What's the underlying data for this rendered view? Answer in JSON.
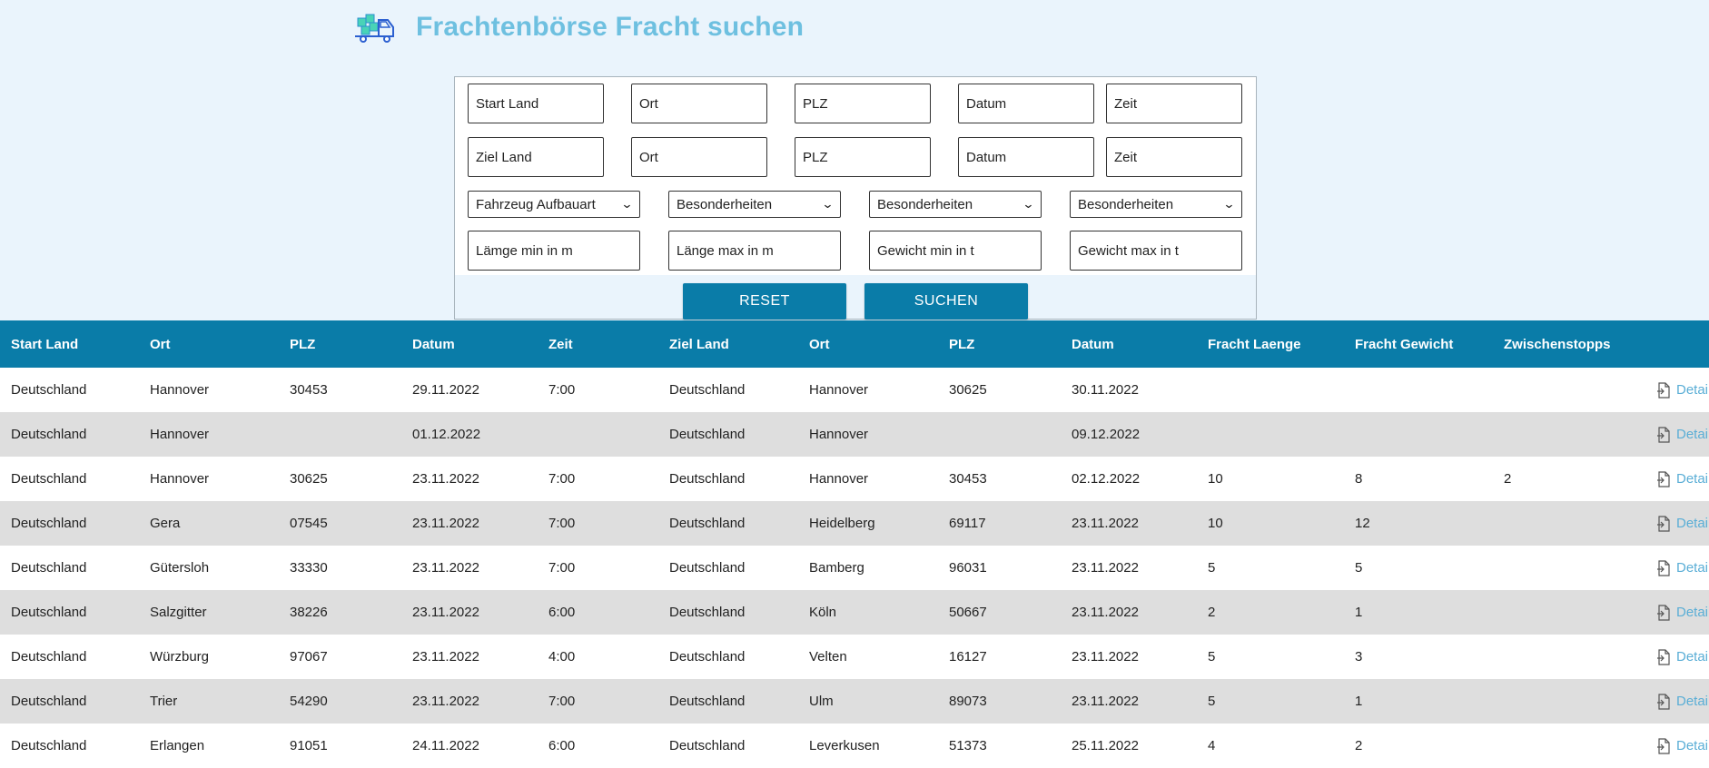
{
  "header": {
    "title": "Frachtenbörse Fracht suchen"
  },
  "search": {
    "start_land": "Start Land",
    "start_ort": "Ort",
    "start_plz": "PLZ",
    "start_datum": "Datum",
    "start_zeit": "Zeit",
    "ziel_land": "Ziel Land",
    "ziel_ort": "Ort",
    "ziel_plz": "PLZ",
    "ziel_datum": "Datum",
    "ziel_zeit": "Zeit",
    "fahrzeug": "Fahrzeug Aufbauart",
    "besonderheiten1": "Besonderheiten",
    "besonderheiten2": "Besonderheiten",
    "besonderheiten3": "Besonderheiten",
    "laenge_min": "Lämge min in m",
    "laenge_max": "Länge max in m",
    "gewicht_min": "Gewicht min in t",
    "gewicht_max": "Gewicht max in t",
    "reset_label": "RESET",
    "suchen_label": "SUCHEN"
  },
  "table": {
    "headers": [
      "Start Land",
      "Ort",
      "PLZ",
      "Datum",
      "Zeit",
      "Ziel Land",
      "Ort",
      "PLZ",
      "Datum",
      "Fracht Laenge",
      "Fracht Gewicht",
      "Zwischenstopps"
    ],
    "details_label": "Details",
    "rows": [
      [
        "Deutschland",
        "Hannover",
        "30453",
        "29.11.2022",
        "7:00",
        "Deutschland",
        "Hannover",
        "30625",
        "30.11.2022",
        "",
        "",
        ""
      ],
      [
        "Deutschland",
        "Hannover",
        "",
        "01.12.2022",
        "",
        "Deutschland",
        "Hannover",
        "",
        "09.12.2022",
        "",
        "",
        ""
      ],
      [
        "Deutschland",
        "Hannover",
        "30625",
        "23.11.2022",
        "7:00",
        "Deutschland",
        "Hannover",
        "30453",
        "02.12.2022",
        "10",
        "8",
        "2"
      ],
      [
        "Deutschland",
        "Gera",
        "07545",
        "23.11.2022",
        "7:00",
        "Deutschland",
        "Heidelberg",
        "69117",
        "23.11.2022",
        "10",
        "12",
        ""
      ],
      [
        "Deutschland",
        "Gütersloh",
        "33330",
        "23.11.2022",
        "7:00",
        "Deutschland",
        "Bamberg",
        "96031",
        "23.11.2022",
        "5",
        "5",
        ""
      ],
      [
        "Deutschland",
        "Salzgitter",
        "38226",
        "23.11.2022",
        "6:00",
        "Deutschland",
        "Köln",
        "50667",
        "23.11.2022",
        "2",
        "1",
        ""
      ],
      [
        "Deutschland",
        "Würzburg",
        "97067",
        "23.11.2022",
        "4:00",
        "Deutschland",
        "Velten",
        "16127",
        "23.11.2022",
        "5",
        "3",
        ""
      ],
      [
        "Deutschland",
        "Trier",
        "54290",
        "23.11.2022",
        "7:00",
        "Deutschland",
        "Ulm",
        "89073",
        "23.11.2022",
        "5",
        "1",
        ""
      ],
      [
        "Deutschland",
        "Erlangen",
        "91051",
        "24.11.2022",
        "6:00",
        "Deutschland",
        "Leverkusen",
        "51373",
        "25.11.2022",
        "4",
        "2",
        ""
      ]
    ]
  }
}
